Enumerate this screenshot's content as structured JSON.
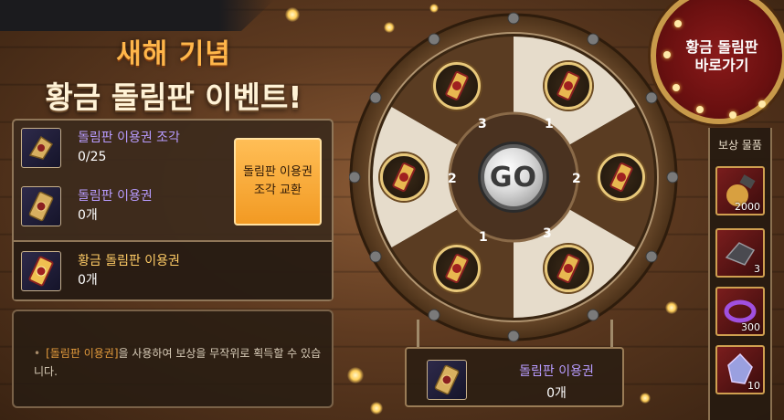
{
  "title": {
    "line1": "새해 기념",
    "line2": "황금 돌림판 이벤트!"
  },
  "inventory": {
    "pieces": {
      "name": "돌림판 이용권 조각",
      "count": "0/25",
      "icon": "ticket-piece-icon"
    },
    "ticket": {
      "name": "돌림판 이용권",
      "count": "0개",
      "icon": "ticket-icon"
    },
    "golden_ticket": {
      "name": "황금 돌림판 이용권",
      "count": "0개",
      "icon": "golden-ticket-icon"
    }
  },
  "exchange_button": {
    "line1": "돌림판 이용권",
    "line2": "조각 교환"
  },
  "info": {
    "highlight": "[돌림판 이용권]",
    "text": "을 사용하여 보상을 무작위로 획득할 수 있습니다."
  },
  "wheel": {
    "go_label": "GO",
    "numbers": [
      "3",
      "1",
      "2",
      "3",
      "1",
      "2"
    ]
  },
  "ticket_box": {
    "name": "돌림판 이용권",
    "count": "0개"
  },
  "shortcut": {
    "line1": "황금 돌림판",
    "line2": "바로가기"
  },
  "rewards": {
    "header": "보상 물품",
    "items": [
      {
        "qty": "2000",
        "icon": "gold-bag-icon"
      },
      {
        "qty": "3",
        "icon": "gauntlet-icon"
      },
      {
        "qty": "300",
        "icon": "ring-icon"
      },
      {
        "qty": "10",
        "icon": "crystal-icon"
      }
    ]
  },
  "colors": {
    "accent_orange": "#f29a23",
    "title_orange": "#ffb64a",
    "item_purple": "#b89cff",
    "gold": "#e8c87a"
  }
}
